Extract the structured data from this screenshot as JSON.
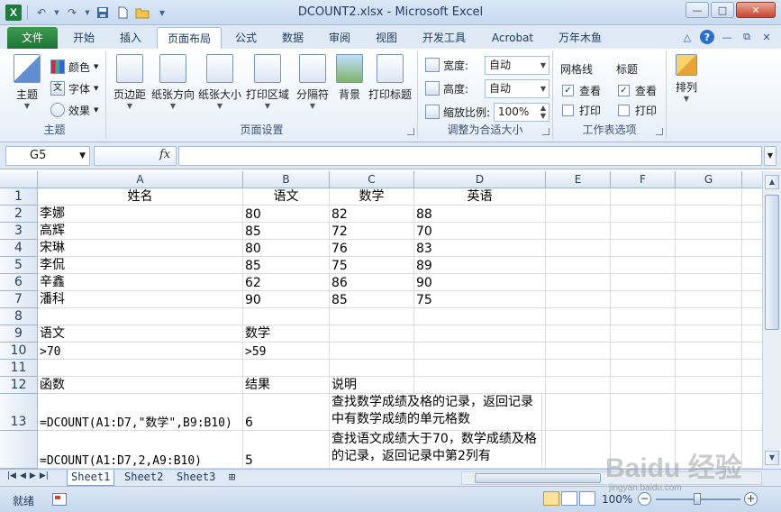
{
  "window": {
    "title": "DCOUNT2.xlsx - Microsoft Excel",
    "app_letter": "X"
  },
  "tabs": [
    "文件",
    "开始",
    "插入",
    "页面布局",
    "公式",
    "数据",
    "审阅",
    "视图",
    "开发工具",
    "Acrobat",
    "万年木鱼"
  ],
  "active_tab": "页面布局",
  "ribbon": {
    "theme_group": {
      "label": "主题",
      "themes": "主题",
      "colors": "颜色",
      "fonts": "字体",
      "effects": "效果"
    },
    "page_setup": {
      "label": "页面设置",
      "margins": "页边距",
      "orientation": "纸张方向",
      "size": "纸张大小",
      "print_area": "打印区域",
      "breaks": "分隔符",
      "background": "背景",
      "print_titles": "打印标题"
    },
    "scale_to_fit": {
      "label": "调整为合适大小",
      "width_label": "宽度:",
      "width_value": "自动",
      "height_label": "高度:",
      "height_value": "自动",
      "scale_label": "缩放比例:",
      "scale_value": "100%"
    },
    "sheet_options": {
      "label": "工作表选项",
      "gridlines": "网格线",
      "headings": "标题",
      "view": "查看",
      "print": "打印"
    },
    "arrange": {
      "label": "排列"
    }
  },
  "formula_bar": {
    "name_box": "G5",
    "fx": "fx",
    "formula": ""
  },
  "columns": [
    "A",
    "B",
    "C",
    "D",
    "E",
    "F",
    "G"
  ],
  "rows": [
    {
      "num": "1",
      "cells": [
        "姓名",
        "语文",
        "数学",
        "英语"
      ],
      "center": true
    },
    {
      "num": "2",
      "cells": [
        "李娜",
        "80",
        "82",
        "88"
      ]
    },
    {
      "num": "3",
      "cells": [
        "高辉",
        "85",
        "72",
        "70"
      ]
    },
    {
      "num": "4",
      "cells": [
        "宋琳",
        "80",
        "76",
        "83"
      ]
    },
    {
      "num": "5",
      "cells": [
        "李侃",
        "85",
        "75",
        "89"
      ]
    },
    {
      "num": "6",
      "cells": [
        "辛鑫",
        "62",
        "86",
        "90"
      ]
    },
    {
      "num": "7",
      "cells": [
        "潘科",
        "90",
        "85",
        "75"
      ]
    },
    {
      "num": "8",
      "cells": [
        "",
        "",
        "",
        ""
      ]
    },
    {
      "num": "9",
      "cells": [
        "语文",
        "数学",
        "",
        ""
      ]
    },
    {
      "num": "10",
      "cells": [
        ">70",
        ">59",
        "",
        ""
      ]
    },
    {
      "num": "11",
      "cells": [
        "",
        "",
        "",
        ""
      ]
    },
    {
      "num": "12",
      "cells": [
        "函数",
        "结果",
        "说明",
        ""
      ]
    },
    {
      "num": "13",
      "cells": [
        "=DCOUNT(A1:D7,\"数学\",B9:B10)",
        "6",
        "查找数学成绩及格的记录，返回记录中有数学成绩的单元格数",
        ""
      ]
    },
    {
      "num": "",
      "cells": [
        "=DCOUNT(A1:D7,2,A9:B10)",
        "5",
        "查找语文成绩大于70，数学成绩及格的记录，返回记录中第2列有",
        ""
      ]
    }
  ],
  "sheets": [
    "Sheet1",
    "Sheet2",
    "Sheet3"
  ],
  "active_sheet": "Sheet1",
  "status": {
    "ready": "就绪",
    "zoom": "100%"
  },
  "watermark": {
    "text": "Baidu 经验",
    "sub": "jingyan.baidu.com"
  }
}
